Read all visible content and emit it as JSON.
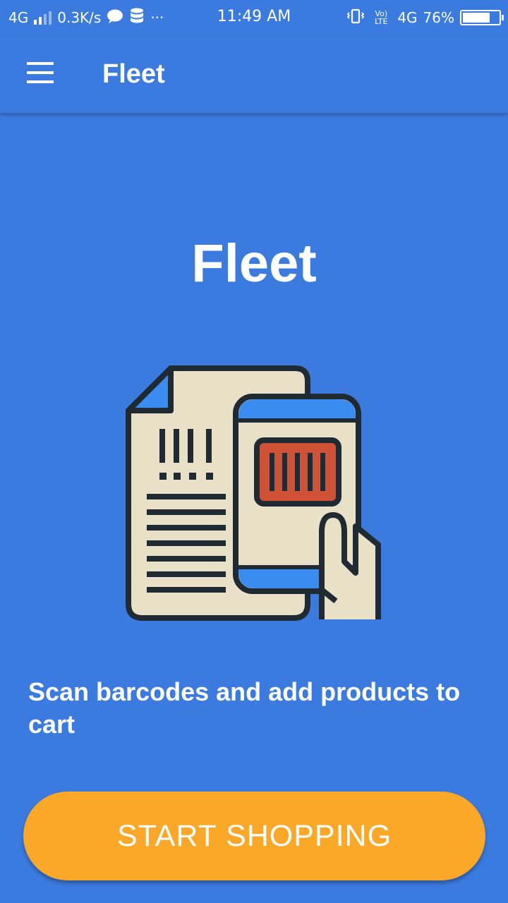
{
  "status_bar": {
    "network_left": "4G",
    "speed": "0.3K/s",
    "more": "···",
    "time": "11:49 AM",
    "volte": "Vo) LTE",
    "network_right": "4G",
    "battery": "76%",
    "battery_level": 0.76
  },
  "app_bar": {
    "title": "Fleet",
    "menu_icon": "hamburger-menu-icon"
  },
  "main": {
    "hero_title": "Fleet",
    "illustration_icon": "barcode-scan-document-phone-icon",
    "caption": "Scan barcodes and add products to cart",
    "cta_label": "START SHOPPING"
  },
  "colors": {
    "primary": "#3b7be0",
    "accent": "#fba727",
    "paper": "#e8e1c8",
    "outline": "#1f2a33",
    "barcode_red": "#cf5236"
  }
}
